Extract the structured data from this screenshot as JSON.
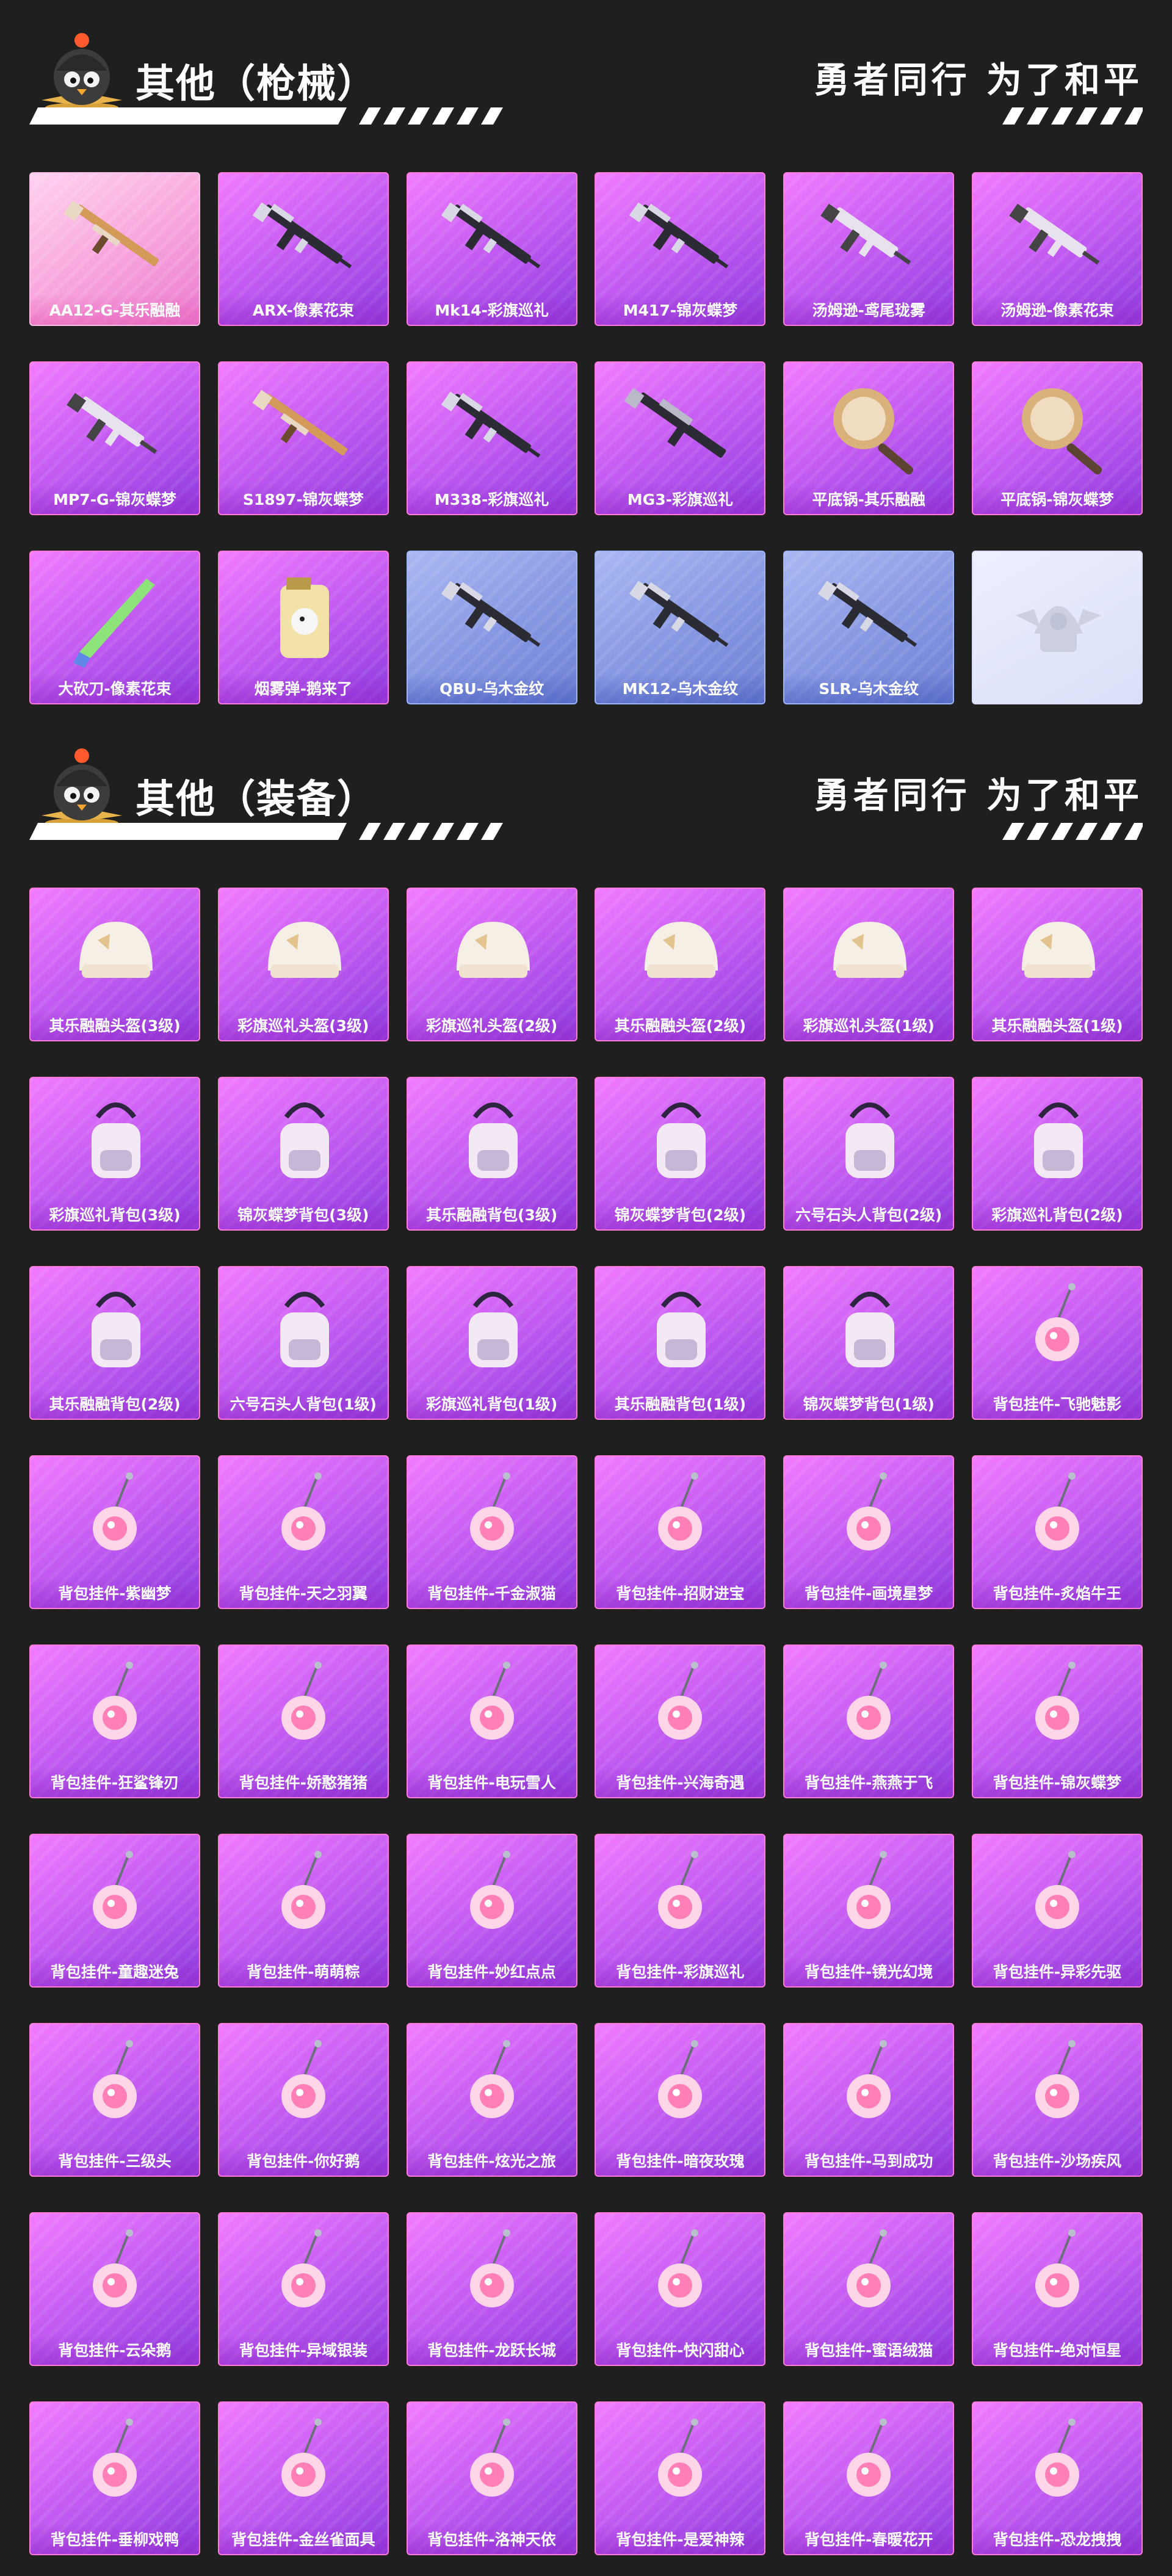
{
  "sections": [
    {
      "title": "其他（枪械）",
      "slogan": "勇者同行 为了和平",
      "items": [
        {
          "label": "AA12-G-其乐融融",
          "icon": "shotgun-icon",
          "variant": "pink"
        },
        {
          "label": "ARX-像素花束",
          "icon": "rifle-icon",
          "variant": "purple"
        },
        {
          "label": "Mk14-彩旗巡礼",
          "icon": "rifle-icon",
          "variant": "purple"
        },
        {
          "label": "M417-锦灰蝶梦",
          "icon": "rifle-icon",
          "variant": "purple"
        },
        {
          "label": "汤姆逊-鸢尾珑雾",
          "icon": "smg-icon",
          "variant": "purple"
        },
        {
          "label": "汤姆逊-像素花束",
          "icon": "smg-icon",
          "variant": "purple"
        },
        {
          "label": "MP7-G-锦灰蝶梦",
          "icon": "smg-icon",
          "variant": "purple"
        },
        {
          "label": "S1897-锦灰蝶梦",
          "icon": "shotgun-icon",
          "variant": "purple"
        },
        {
          "label": "M338-彩旗巡礼",
          "icon": "rifle-icon",
          "variant": "purple"
        },
        {
          "label": "MG3-彩旗巡礼",
          "icon": "machine-gun-icon",
          "variant": "purple"
        },
        {
          "label": "平底锅-其乐融融",
          "icon": "frying-pan-icon",
          "variant": "purple"
        },
        {
          "label": "平底锅-锦灰蝶梦",
          "icon": "frying-pan-icon",
          "variant": "purple"
        },
        {
          "label": "大砍刀-像素花束",
          "icon": "machete-icon",
          "variant": "purple"
        },
        {
          "label": "烟雾弹-鹅来了",
          "icon": "smoke-grenade-icon",
          "variant": "purple"
        },
        {
          "label": "QBU-乌木金纹",
          "icon": "rifle-icon",
          "variant": "blue"
        },
        {
          "label": "MK12-乌木金纹",
          "icon": "rifle-icon",
          "variant": "blue"
        },
        {
          "label": "SLR-乌木金纹",
          "icon": "rifle-icon",
          "variant": "blue"
        },
        {
          "label": "",
          "icon": "placeholder-emblem-icon",
          "variant": "light"
        }
      ]
    },
    {
      "title": "其他（装备）",
      "slogan": "勇者同行 为了和平",
      "items": [
        {
          "label": "其乐融融头盔(3级)",
          "icon": "helmet-icon",
          "variant": "purple"
        },
        {
          "label": "彩旗巡礼头盔(3级)",
          "icon": "helmet-icon",
          "variant": "purple"
        },
        {
          "label": "彩旗巡礼头盔(2级)",
          "icon": "helmet-icon",
          "variant": "purple"
        },
        {
          "label": "其乐融融头盔(2级)",
          "icon": "helmet-icon",
          "variant": "purple"
        },
        {
          "label": "彩旗巡礼头盔(1级)",
          "icon": "helmet-icon",
          "variant": "purple"
        },
        {
          "label": "其乐融融头盔(1级)",
          "icon": "helmet-icon",
          "variant": "purple"
        },
        {
          "label": "彩旗巡礼背包(3级)",
          "icon": "backpack-icon",
          "variant": "purple"
        },
        {
          "label": "锦灰蝶梦背包(3级)",
          "icon": "backpack-icon",
          "variant": "purple"
        },
        {
          "label": "其乐融融背包(3级)",
          "icon": "backpack-icon",
          "variant": "purple"
        },
        {
          "label": "锦灰蝶梦背包(2级)",
          "icon": "backpack-icon",
          "variant": "purple"
        },
        {
          "label": "六号石头人背包(2级)",
          "icon": "backpack-icon",
          "variant": "purple"
        },
        {
          "label": "彩旗巡礼背包(2级)",
          "icon": "backpack-icon",
          "variant": "purple"
        },
        {
          "label": "其乐融融背包(2级)",
          "icon": "backpack-icon",
          "variant": "purple"
        },
        {
          "label": "六号石头人背包(1级)",
          "icon": "backpack-icon",
          "variant": "purple"
        },
        {
          "label": "彩旗巡礼背包(1级)",
          "icon": "backpack-icon",
          "variant": "purple"
        },
        {
          "label": "其乐融融背包(1级)",
          "icon": "backpack-icon",
          "variant": "purple"
        },
        {
          "label": "锦灰蝶梦背包(1级)",
          "icon": "backpack-icon",
          "variant": "purple"
        },
        {
          "label": "背包挂件-飞驰魅影",
          "icon": "charm-icon",
          "variant": "purple"
        },
        {
          "label": "背包挂件-紫幽梦",
          "icon": "charm-icon",
          "variant": "purple"
        },
        {
          "label": "背包挂件-天之羽翼",
          "icon": "charm-icon",
          "variant": "purple"
        },
        {
          "label": "背包挂件-千金淑猫",
          "icon": "charm-icon",
          "variant": "purple"
        },
        {
          "label": "背包挂件-招财进宝",
          "icon": "charm-icon",
          "variant": "purple"
        },
        {
          "label": "背包挂件-画境星梦",
          "icon": "charm-icon",
          "variant": "purple"
        },
        {
          "label": "背包挂件-炙焰牛王",
          "icon": "charm-icon",
          "variant": "purple"
        },
        {
          "label": "背包挂件-狂鲨锋刃",
          "icon": "charm-icon",
          "variant": "purple"
        },
        {
          "label": "背包挂件-娇憨猪猪",
          "icon": "charm-icon",
          "variant": "purple"
        },
        {
          "label": "背包挂件-电玩雪人",
          "icon": "charm-icon",
          "variant": "purple"
        },
        {
          "label": "背包挂件-兴海奇遇",
          "icon": "charm-icon",
          "variant": "purple"
        },
        {
          "label": "背包挂件-燕燕于飞",
          "icon": "charm-icon",
          "variant": "purple"
        },
        {
          "label": "背包挂件-锦灰蝶梦",
          "icon": "charm-icon",
          "variant": "purple"
        },
        {
          "label": "背包挂件-童趣迷兔",
          "icon": "charm-icon",
          "variant": "purple"
        },
        {
          "label": "背包挂件-萌萌粽",
          "icon": "charm-icon",
          "variant": "purple"
        },
        {
          "label": "背包挂件-妙红点点",
          "icon": "charm-icon",
          "variant": "purple"
        },
        {
          "label": "背包挂件-彩旗巡礼",
          "icon": "charm-icon",
          "variant": "purple"
        },
        {
          "label": "背包挂件-镜光幻境",
          "icon": "charm-icon",
          "variant": "purple"
        },
        {
          "label": "背包挂件-异彩先驱",
          "icon": "charm-icon",
          "variant": "purple"
        },
        {
          "label": "背包挂件-三级头",
          "icon": "charm-icon",
          "variant": "purple"
        },
        {
          "label": "背包挂件-你好鹅",
          "icon": "charm-icon",
          "variant": "purple"
        },
        {
          "label": "背包挂件-炫光之旅",
          "icon": "charm-icon",
          "variant": "purple"
        },
        {
          "label": "背包挂件-暗夜玫瑰",
          "icon": "charm-icon",
          "variant": "purple"
        },
        {
          "label": "背包挂件-马到成功",
          "icon": "charm-icon",
          "variant": "purple"
        },
        {
          "label": "背包挂件-沙场疾风",
          "icon": "charm-icon",
          "variant": "purple"
        },
        {
          "label": "背包挂件-云朵鹅",
          "icon": "charm-icon",
          "variant": "purple"
        },
        {
          "label": "背包挂件-异域银装",
          "icon": "charm-icon",
          "variant": "purple"
        },
        {
          "label": "背包挂件-龙跃长城",
          "icon": "charm-icon",
          "variant": "purple"
        },
        {
          "label": "背包挂件-快闪甜心",
          "icon": "charm-icon",
          "variant": "purple"
        },
        {
          "label": "背包挂件-蜜语绒猫",
          "icon": "charm-icon",
          "variant": "purple"
        },
        {
          "label": "背包挂件-绝对恒星",
          "icon": "charm-icon",
          "variant": "purple"
        },
        {
          "label": "背包挂件-垂柳戏鸭",
          "icon": "charm-icon",
          "variant": "purple"
        },
        {
          "label": "背包挂件-金丝雀面具",
          "icon": "charm-icon",
          "variant": "purple"
        },
        {
          "label": "背包挂件-洛神天依",
          "icon": "charm-icon",
          "variant": "purple"
        },
        {
          "label": "背包挂件-是爱神辣",
          "icon": "charm-icon",
          "variant": "purple"
        },
        {
          "label": "背包挂件-春暖花开",
          "icon": "charm-icon",
          "variant": "purple"
        },
        {
          "label": "背包挂件-恐龙拽拽",
          "icon": "charm-icon",
          "variant": "purple"
        }
      ]
    }
  ],
  "colors": {
    "background": "#1f1f1f",
    "card_purple": "#c35bf2",
    "card_pink": "#f7a3dc",
    "card_blue": "#8697e2",
    "card_light": "#dadff8"
  }
}
